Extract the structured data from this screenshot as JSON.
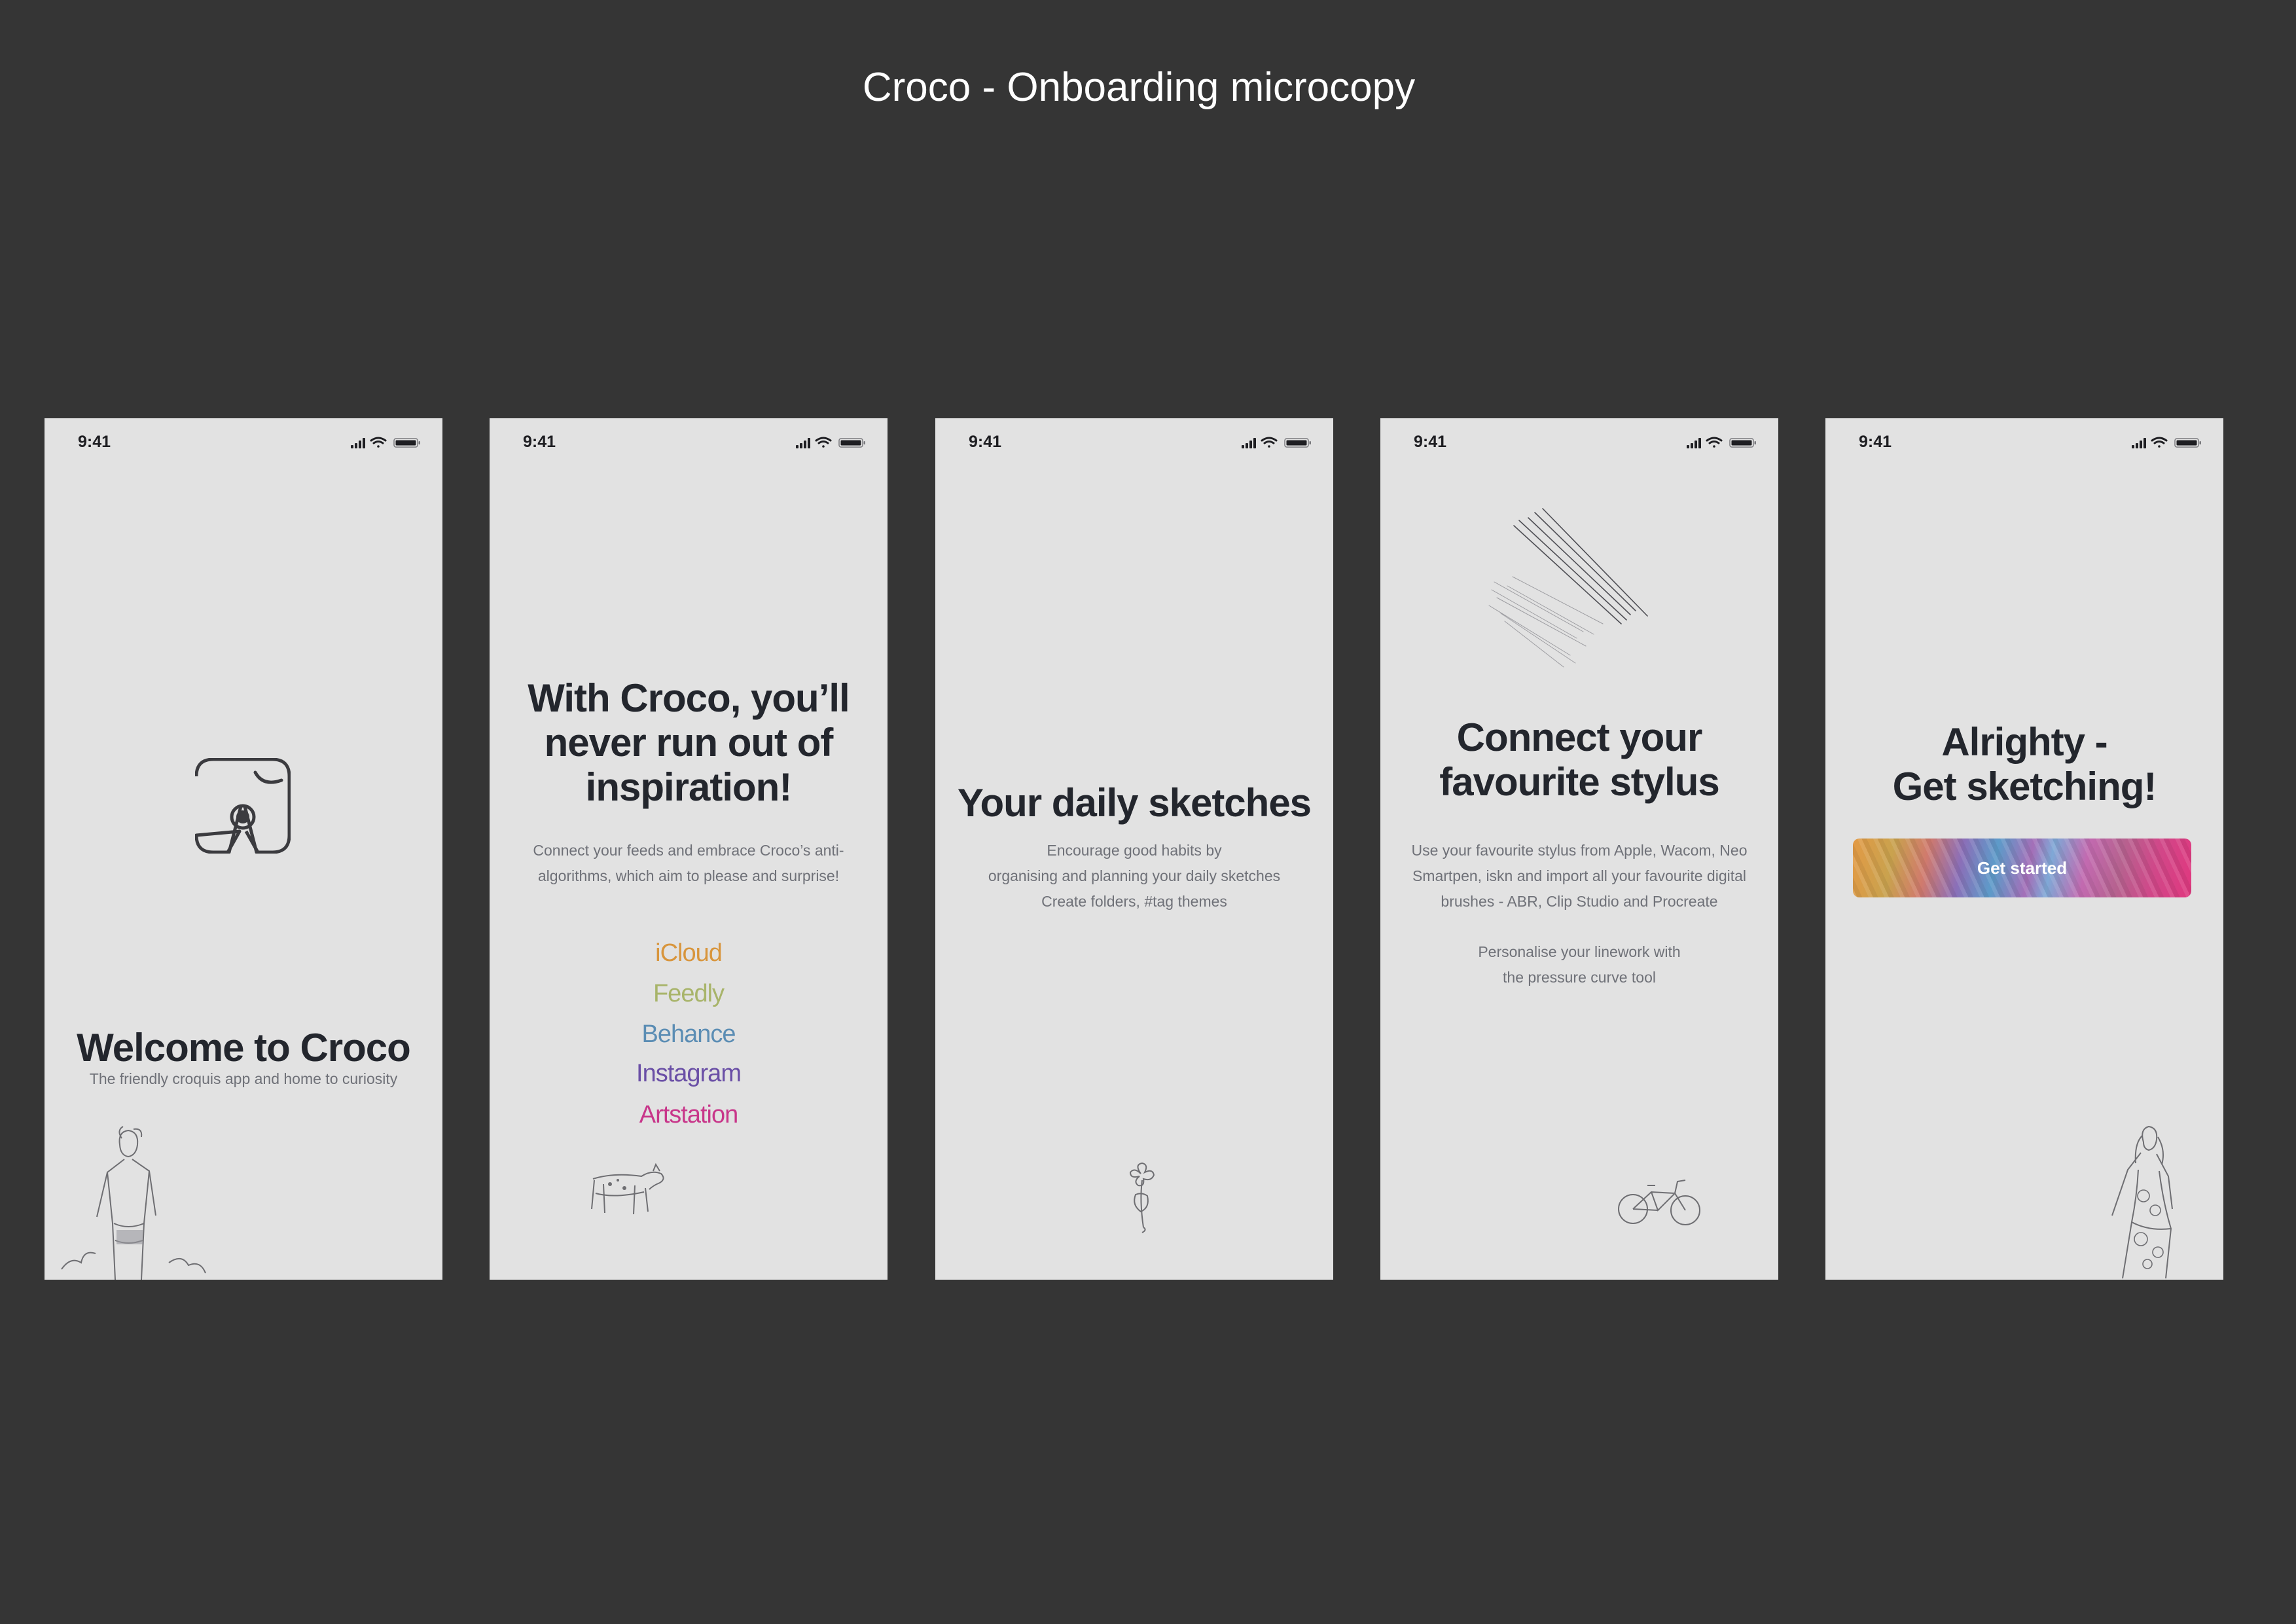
{
  "page": {
    "title": "Croco - Onboarding microcopy"
  },
  "colors": {
    "background": "#353535",
    "screen": "#e2e2e2",
    "heading": "#23262d",
    "body": "#6f7178"
  },
  "screens": [
    {
      "status_time": "9:41",
      "heading": [
        "Welcome to Croco"
      ],
      "body": [
        "The friendly croquis app and home to curiosity"
      ],
      "icons": [
        "croco-logo-icon",
        "figure-sketch-illustration"
      ]
    },
    {
      "status_time": "9:41",
      "heading": [
        "With Croco, you’ll",
        "never run out of",
        "inspiration!"
      ],
      "body": [
        "Connect your feeds and embrace Croco’s anti-",
        "algorithms, which aim to please and surprise!"
      ],
      "services": [
        {
          "label": "iCloud",
          "color": "#d8953c"
        },
        {
          "label": "Feedly",
          "color": "#a8b46a"
        },
        {
          "label": "Behance",
          "color": "#5b8db4"
        },
        {
          "label": "Instagram",
          "color": "#6a4fa6"
        },
        {
          "label": "Artstation",
          "color": "#c8368a"
        }
      ],
      "icons": [
        "dog-sketch-illustration"
      ]
    },
    {
      "status_time": "9:41",
      "heading": [
        "Your daily sketches"
      ],
      "body": [
        "Encourage good habits by",
        "organising and planning your daily sketches",
        "Create folders, #tag themes"
      ],
      "icons": [
        "flower-sketch-illustration"
      ]
    },
    {
      "status_time": "9:41",
      "heading": [
        "Connect your",
        "favourite stylus"
      ],
      "body": [
        "Use your favourite stylus from Apple, Wacom, Neo",
        "Smartpen, iskn and import all your favourite digital",
        "brushes - ABR, Clip Studio and Procreate"
      ],
      "body2": [
        "Personalise your linework with",
        "the pressure curve tool"
      ],
      "icons": [
        "pencil-strokes-illustration",
        "bicycle-sketch-illustration"
      ]
    },
    {
      "status_time": "9:41",
      "heading": [
        "Alrighty -",
        "Get sketching!"
      ],
      "cta": "Get started",
      "icons": [
        "woman-dress-sketch-illustration"
      ]
    }
  ]
}
